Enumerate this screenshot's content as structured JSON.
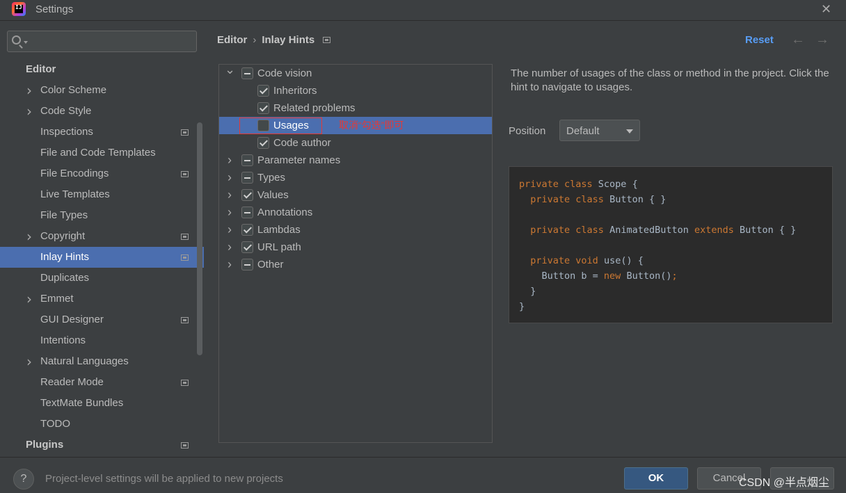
{
  "window": {
    "title": "Settings",
    "close_icon": "close-icon"
  },
  "sidebar": {
    "search": {
      "placeholder": "",
      "value": ""
    },
    "items": [
      {
        "label": "Editor",
        "type": "section"
      },
      {
        "label": "Color Scheme",
        "expandable": true
      },
      {
        "label": "Code Style",
        "expandable": true
      },
      {
        "label": "Inspections",
        "badge": true
      },
      {
        "label": "File and Code Templates"
      },
      {
        "label": "File Encodings",
        "badge": true
      },
      {
        "label": "Live Templates"
      },
      {
        "label": "File Types"
      },
      {
        "label": "Copyright",
        "expandable": true,
        "badge": true
      },
      {
        "label": "Inlay Hints",
        "badge": true,
        "selected": true
      },
      {
        "label": "Duplicates"
      },
      {
        "label": "Emmet",
        "expandable": true
      },
      {
        "label": "GUI Designer",
        "badge": true
      },
      {
        "label": "Intentions"
      },
      {
        "label": "Natural Languages",
        "expandable": true
      },
      {
        "label": "Reader Mode",
        "badge": true
      },
      {
        "label": "TextMate Bundles"
      },
      {
        "label": "TODO"
      },
      {
        "label": "Plugins",
        "type": "section",
        "badge": true
      }
    ]
  },
  "header": {
    "breadcrumb": [
      "Editor",
      "Inlay Hints"
    ],
    "reset_label": "Reset"
  },
  "options": {
    "rows": [
      {
        "label": "Code vision",
        "level": 0,
        "toggle": "expanded",
        "state": "partial"
      },
      {
        "label": "Inheritors",
        "level": 1,
        "state": "checked"
      },
      {
        "label": "Related problems",
        "level": 1,
        "state": "checked"
      },
      {
        "label": "Usages",
        "level": 1,
        "state": "unchecked",
        "selected": true
      },
      {
        "label": "Code author",
        "level": 1,
        "state": "checked"
      },
      {
        "label": "Parameter names",
        "level": 0,
        "toggle": "collapsed",
        "state": "partial"
      },
      {
        "label": "Types",
        "level": 0,
        "toggle": "collapsed",
        "state": "partial"
      },
      {
        "label": "Values",
        "level": 0,
        "toggle": "collapsed",
        "state": "checked"
      },
      {
        "label": "Annotations",
        "level": 0,
        "toggle": "collapsed",
        "state": "partial"
      },
      {
        "label": "Lambdas",
        "level": 0,
        "toggle": "collapsed",
        "state": "checked"
      },
      {
        "label": "URL path",
        "level": 0,
        "toggle": "collapsed",
        "state": "checked"
      },
      {
        "label": "Other",
        "level": 0,
        "toggle": "collapsed",
        "state": "partial"
      }
    ],
    "annotation_text": "取消“勾选”即可"
  },
  "detail": {
    "description": "The number of usages of the class or method in the project. Click the hint to navigate to usages.",
    "position_label": "Position",
    "position_value": "Default"
  },
  "code_preview": [
    [
      [
        "kw",
        "private class "
      ],
      [
        "t",
        "Scope {"
      ]
    ],
    [
      [
        "t",
        "  "
      ],
      [
        "kw",
        "private class "
      ],
      [
        "t",
        "Button { }"
      ]
    ],
    [],
    [
      [
        "t",
        "  "
      ],
      [
        "kw",
        "private class "
      ],
      [
        "t",
        "AnimatedButton "
      ],
      [
        "kw",
        "extends "
      ],
      [
        "t",
        "Button { }"
      ]
    ],
    [],
    [
      [
        "t",
        "  "
      ],
      [
        "kw",
        "private void "
      ],
      [
        "t",
        "use() {"
      ]
    ],
    [
      [
        "t",
        "    Button b = "
      ],
      [
        "kw",
        "new "
      ],
      [
        "t",
        "Button()"
      ],
      [
        "kw",
        ";"
      ]
    ],
    [
      [
        "t",
        "  }"
      ]
    ],
    [
      [
        "t",
        "}"
      ]
    ]
  ],
  "footer": {
    "help_label": "?",
    "note": "Project-level settings will be applied to new projects",
    "ok_label": "OK",
    "cancel_label": "Cancel",
    "watermark": "CSDN @半点烟尘"
  },
  "colors": {
    "selection": "#4b6eaf",
    "accent": "#589df6",
    "annotation": "#e53935",
    "keyword": "#cc7832"
  }
}
